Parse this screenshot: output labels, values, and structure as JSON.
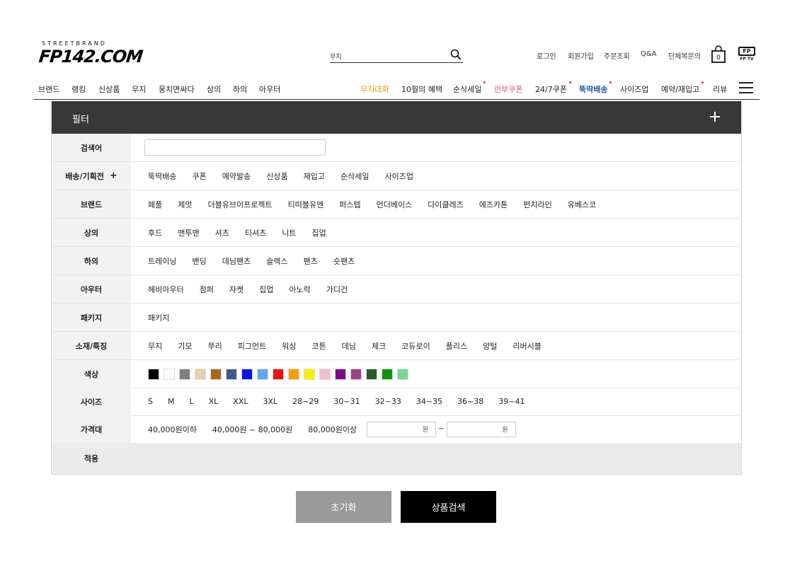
{
  "header": {
    "logo_tag": "STREETBRAND",
    "logo_text": "FP142.COM",
    "search_value": "무지",
    "util_links": [
      "로그인",
      "회원가입",
      "주문조회",
      "Q&A",
      "단체복문의"
    ],
    "cart_count": "0",
    "fptv_label": "FP TV",
    "fptv_box": "FP"
  },
  "nav": {
    "left": [
      "브랜드",
      "랭킹",
      "신상품",
      "무지",
      "뭉치면싸다",
      "상의",
      "하의",
      "아우터"
    ],
    "right": [
      "무지대회",
      "10월의 혜택",
      "순삭세일",
      "깐부쿠폰",
      "24/7쿠폰",
      "뚝딱배송",
      "사이즈업",
      "예약/재입고",
      "리뷰"
    ]
  },
  "filter": {
    "title": "필터",
    "keyword_label": "검색어",
    "shipping_label": "배송/기획전",
    "shipping_plus": "+",
    "shipping": [
      "뚝딱배송",
      "쿠폰",
      "예약발송",
      "신상품",
      "재입고",
      "순삭세일",
      "사이즈업"
    ],
    "brand_label": "브랜드",
    "brands": [
      "페플",
      "제멋",
      "더블유브이프로젝트",
      "티떠블유엔",
      "퍼스텝",
      "언더베이스",
      "다이클레즈",
      "에즈카톤",
      "펀치라인",
      "유베스코"
    ],
    "top_label": "상의",
    "tops": [
      "후드",
      "맨투맨",
      "셔츠",
      "티셔츠",
      "니트",
      "집업"
    ],
    "bottom_label": "하의",
    "bottoms": [
      "트레이닝",
      "밴딩",
      "데님팬츠",
      "슬랙스",
      "팬츠",
      "숏팬츠"
    ],
    "outer_label": "아우터",
    "outers": [
      "헤비아우터",
      "점퍼",
      "자켓",
      "집업",
      "아노락",
      "가디건"
    ],
    "package_label": "패키지",
    "packages": [
      "패키지"
    ],
    "material_label": "소재/특징",
    "materials": [
      "무지",
      "기모",
      "쭈리",
      "피그먼트",
      "워싱",
      "코튼",
      "데님",
      "체크",
      "코듀로이",
      "플리스",
      "양털",
      "리버시블"
    ],
    "color_label": "색상",
    "colors": [
      "#000000",
      "#ffffff",
      "#808080",
      "#e8cdb0",
      "#a8661b",
      "#3f5a8a",
      "#0a14f0",
      "#5fa8f0",
      "#f01010",
      "#f7a000",
      "#f7f200",
      "#f7bcc8",
      "#7c0a8a",
      "#a23c86",
      "#2c5a2c",
      "#089808",
      "#78d890"
    ],
    "size_label": "사이즈",
    "sizes": [
      "S",
      "M",
      "L",
      "XL",
      "XXL",
      "3XL",
      "28~29",
      "30~31",
      "32~33",
      "34~35",
      "36~38",
      "39~41"
    ],
    "price_label": "가격대",
    "prices": [
      "40,000원이하",
      "40,000원 ~ 80,000원",
      "80,000원이상"
    ],
    "price_unit": "원",
    "price_sep": "~",
    "apply_label": "적용"
  },
  "buttons": {
    "reset": "초기화",
    "search": "상품검색"
  }
}
